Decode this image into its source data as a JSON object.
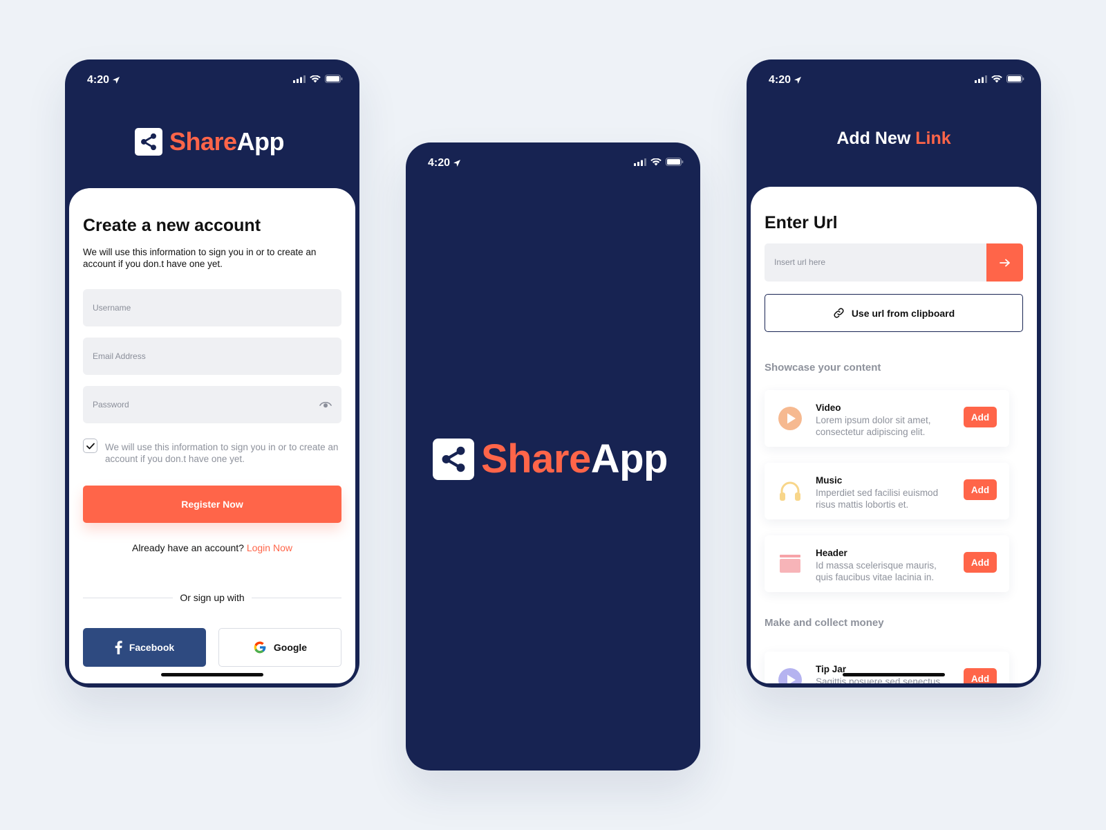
{
  "status_bar": {
    "time": "4:20"
  },
  "brand": {
    "share": "Share",
    "app": "App"
  },
  "login": {
    "heading": "Create a new account",
    "subtext": "We will use this information to sign you in or to create an account if you don.t have one yet.",
    "fields": {
      "username": "Username",
      "email": "Email Address",
      "password": "Password"
    },
    "consent": "We will use this information to sign you in or to create an account if you don.t have one yet.",
    "register_label": "Register Now",
    "login_prompt": "Already have an account?",
    "login_link": "Login Now",
    "divider_label": "Or sign up with",
    "facebook_label": "Facebook",
    "google_label": "Google"
  },
  "link_screen": {
    "title_main": "Add New",
    "title_accent": "Link",
    "heading": "Enter Url",
    "url_placeholder": "Insert url here",
    "clipboard_label": "Use url from clipboard",
    "showcase_label": "Showcase your content",
    "money_label": "Make and collect money",
    "add_label": "Add",
    "cards": [
      {
        "title": "Video",
        "desc": "Lorem ipsum dolor sit amet, consectetur adipiscing elit."
      },
      {
        "title": "Music",
        "desc": "Imperdiet sed facilisi euismod risus mattis lobortis et."
      },
      {
        "title": "Header",
        "desc": "Id massa scelerisque mauris, quis faucibus vitae lacinia in."
      },
      {
        "title": "Tip Jar",
        "desc": "Sagittis posuere sed senectus"
      }
    ]
  },
  "colors": {
    "navy": "#172352",
    "accent": "#ff6549",
    "facebook": "#2e4a80",
    "field_bg": "#eff0f3",
    "muted_text": "#8e929c"
  },
  "icons": {
    "location": "location-arrow-icon",
    "signal": "signal-icon",
    "wifi": "wifi-icon",
    "battery": "battery-icon",
    "share": "share-icon",
    "eye": "eye-icon",
    "check": "check-icon",
    "facebook": "facebook-icon",
    "google": "google-icon",
    "arrow": "arrow-right-icon",
    "link": "link-icon",
    "video": "play-icon",
    "music": "headphones-icon",
    "header": "header-icon",
    "tip": "tip-jar-icon"
  }
}
